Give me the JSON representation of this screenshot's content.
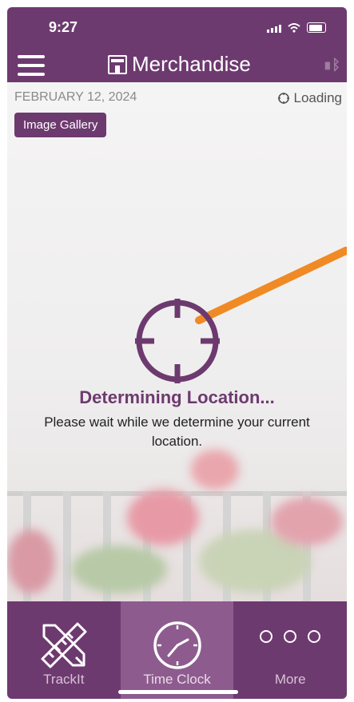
{
  "status_bar": {
    "time": "9:27"
  },
  "header": {
    "app_title": "Merchandise",
    "left_icon": "hamburger-menu-icon",
    "brand_icon": "store-icon",
    "right_icon": "bluetooth-scanner-icon"
  },
  "info_row": {
    "date": "FEBRUARY 12, 2024",
    "location_status": "Loading"
  },
  "gallery_button": "Image Gallery",
  "overlay": {
    "title": "Determining Location...",
    "message": "Please wait while we determine your current location.",
    "accent_color": "#6d3a6f",
    "arrow_color": "#f08a24"
  },
  "tabs": [
    {
      "label": "TrackIt",
      "icon": "pencil-ruler-icon"
    },
    {
      "label": "Time Clock",
      "icon": "clock-icon"
    },
    {
      "label": "More",
      "icon": "more-dots-icon"
    }
  ]
}
